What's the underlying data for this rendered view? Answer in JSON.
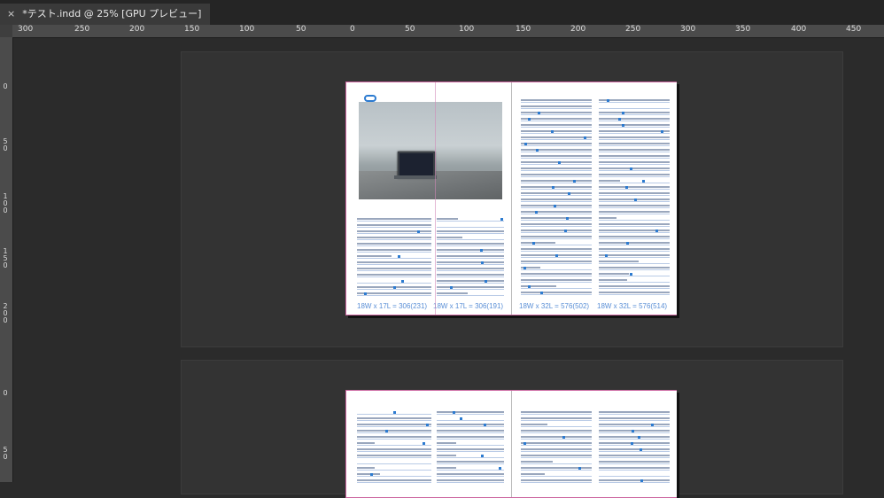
{
  "document_tab": {
    "close_symbol": "×",
    "title": "*テスト.indd @ 25% [GPU プレビュー]"
  },
  "ruler_h": [
    "300",
    "250",
    "200",
    "150",
    "100",
    "50",
    "0",
    "50",
    "100",
    "150",
    "200",
    "250",
    "300",
    "350",
    "400",
    "450"
  ],
  "ruler_v": [
    "0",
    "50",
    "100",
    "150",
    "200",
    "0",
    "50"
  ],
  "spread1": {
    "frame_labels": [
      "18W x 17L = 306(231)",
      "18W x 17L = 306(191)",
      "18W x 32L = 576(502)",
      "18W x 32L = 576(514)"
    ]
  },
  "icons": [
    "close-icon",
    "link-icon"
  ]
}
